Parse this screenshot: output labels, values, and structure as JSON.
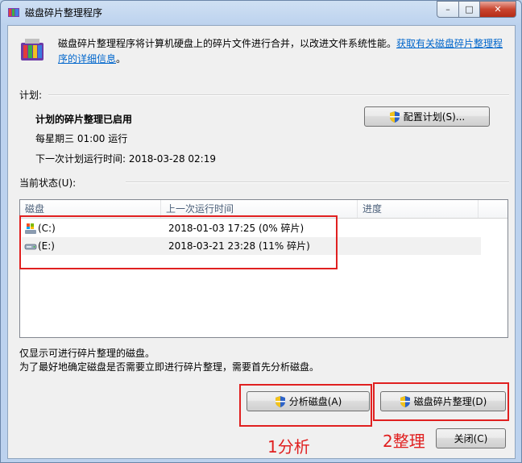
{
  "window": {
    "title": "磁盘碎片整理程序",
    "minimize": "–",
    "maximize": "□",
    "close": "✕"
  },
  "intro": {
    "text": "磁盘碎片整理程序将计算机硬盘上的碎片文件进行合并，以改进文件系统性能。",
    "link": "获取有关磁盘碎片整理程序的详细信息",
    "suffix": "。"
  },
  "schedule": {
    "label": "计划:",
    "status": "计划的碎片整理已启用",
    "when": "每星期三  01:00 运行",
    "next_run": "下一次计划运行时间: 2018-03-28 02:19",
    "configure_button": "配置计划(S)..."
  },
  "current": {
    "label": "当前状态(U):",
    "columns": [
      "磁盘",
      "上一次运行时间",
      "进度"
    ],
    "rows": [
      {
        "disk": "(C:)",
        "last_run": "2018-01-03 17:25 (0% 碎片)",
        "progress": "",
        "icon": "system-drive-icon"
      },
      {
        "disk": "(E:)",
        "last_run": "2018-03-21 23:28 (11% 碎片)",
        "progress": "",
        "icon": "hard-drive-icon"
      }
    ]
  },
  "notes": {
    "line1": "仅显示可进行碎片整理的磁盘。",
    "line2": "为了最好地确定磁盘是否需要立即进行碎片整理，需要首先分析磁盘。"
  },
  "buttons": {
    "analyze": "分析磁盘(A)",
    "defrag": "磁盘碎片整理(D)",
    "close": "关闭(C)"
  },
  "annotations": {
    "step1": "1分析",
    "step2": "2整理",
    "color": "#e02020"
  }
}
